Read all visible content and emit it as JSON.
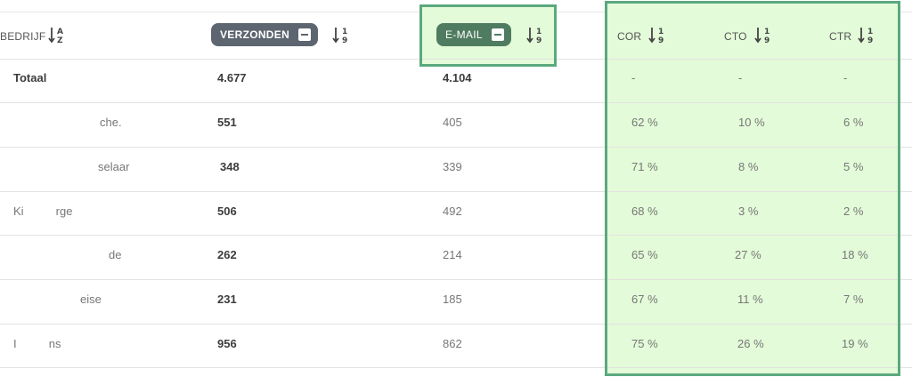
{
  "table": {
    "headers": {
      "bedrijf": "BEDRIJF",
      "verzonden": "VERZONDEN",
      "email": "E-MAIL",
      "cor": "COR",
      "cto": "CTO",
      "ctr": "CTR"
    },
    "sort_icons": {
      "alpha": "sort-alpha-az-icon",
      "numeric": "sort-numeric-19-icon"
    },
    "total": {
      "label": "Totaal",
      "verzonden": "4.677",
      "email": "4.104",
      "cor": "-",
      "cto": "-",
      "ctr": "-"
    },
    "rows": [
      {
        "company": "che.",
        "verzonden": "551",
        "email": "405",
        "cor": "62 %",
        "cto": "10 %",
        "ctr": "6 %"
      },
      {
        "company": "selaar",
        "verzonden": "348",
        "email": "339",
        "cor": "71 %",
        "cto": "8 %",
        "ctr": "5 %"
      },
      {
        "company": "Ki          rge",
        "verzonden": "506",
        "email": "492",
        "cor": "68 %",
        "cto": "3 %",
        "ctr": "2 %"
      },
      {
        "company": "de",
        "verzonden": "262",
        "email": "214",
        "cor": "65 %",
        "cto": "27 %",
        "ctr": "18 %"
      },
      {
        "company": "eise",
        "verzonden": "231",
        "email": "185",
        "cor": "67 %",
        "cto": "11 %",
        "ctr": "7 %"
      },
      {
        "company": "I          ns",
        "verzonden": "956",
        "email": "862",
        "cor": "75 %",
        "cto": "26 %",
        "ctr": "19 %"
      }
    ]
  },
  "colors": {
    "highlight_bg": "#e3fbd8",
    "highlight_border": "#5aa97e",
    "pill_grey": "#5d6670",
    "pill_green": "#4f7b60"
  }
}
